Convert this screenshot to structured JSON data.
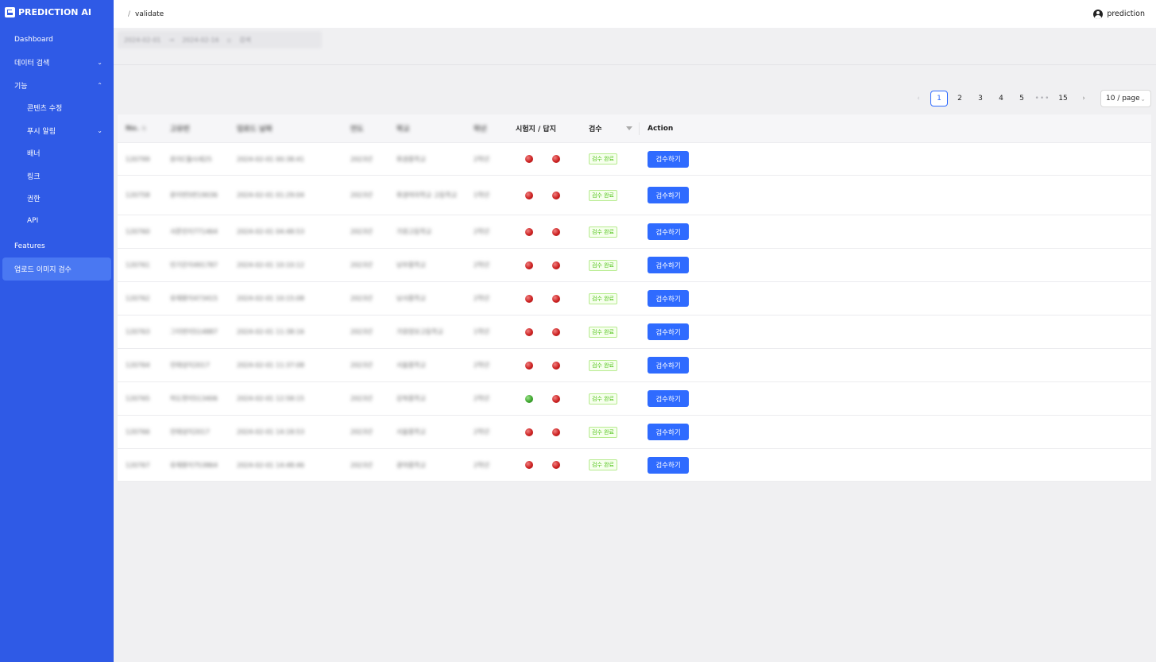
{
  "brand": {
    "name": "PREDICTION AI"
  },
  "sidebar": {
    "items": [
      {
        "label": "Dashboard",
        "chevron": ""
      },
      {
        "label": "데이터 검색",
        "chevron": "⌄"
      },
      {
        "label": "기능",
        "chevron": "⌃"
      },
      {
        "label": "콘텐츠 수정",
        "chevron": ""
      },
      {
        "label": "푸시 알림",
        "chevron": "⌄"
      },
      {
        "label": "배너",
        "chevron": ""
      },
      {
        "label": "링크",
        "chevron": ""
      },
      {
        "label": "권한",
        "chevron": ""
      },
      {
        "label": "API",
        "chevron": ""
      },
      {
        "label": "Features",
        "chevron": ""
      },
      {
        "label": "업로드 이미지 검수",
        "chevron": ""
      }
    ]
  },
  "header": {
    "breadcrumb_sep": "/",
    "breadcrumb_current": "validate",
    "user_name": "prediction"
  },
  "filter": {
    "start_date": "2024-02-01",
    "end_date": "2024-02-16",
    "search_label": "검색"
  },
  "pagination": {
    "pages": [
      "1",
      "2",
      "3",
      "4",
      "5"
    ],
    "dots": "•••",
    "last": "15",
    "prev": "‹",
    "next": "›",
    "page_size": "10 / page"
  },
  "table": {
    "headers": {
      "no": "No.",
      "name": "고유번",
      "date": "업로드 날짜",
      "year": "연도",
      "school": "학교",
      "grade": "학년",
      "paper": "시험지 / 답지",
      "status": "검수",
      "action": "Action"
    },
    "rows": [
      {
        "no": "120799",
        "name": "윤리C월시세25",
        "date": "2024-02-01 00:38:41",
        "year": "2023년",
        "school": "휘경중학교",
        "grade": "2학년",
        "exam": "red",
        "answer": "red",
        "status": "검수 완료",
        "action": "검수하기"
      },
      {
        "no": "120758",
        "name": "윤이번5번19036",
        "date": "2024-02-01 01:29:04",
        "year": "2023년",
        "school": "휘경여자학교 고등학교",
        "grade": "1학년",
        "exam": "red",
        "answer": "red",
        "status": "검수 완료",
        "action": "검수하기"
      },
      {
        "no": "120760",
        "name": "서준민이771464",
        "date": "2024-02-01 04:48:53",
        "year": "2023년",
        "school": "가원고등학교",
        "grade": "2학년",
        "exam": "red",
        "answer": "red",
        "status": "검수 완료",
        "action": "검수하기"
      },
      {
        "no": "120761",
        "name": "민기은이491787",
        "date": "2024-02-01 10:10:12",
        "year": "2023년",
        "school": "남부중학교",
        "grade": "2학년",
        "exam": "red",
        "answer": "red",
        "status": "검수 완료",
        "action": "검수하기"
      },
      {
        "no": "120762",
        "name": "유재환이473415",
        "date": "2024-02-01 10:15:08",
        "year": "2023년",
        "school": "남서중학교",
        "grade": "2학년",
        "exam": "red",
        "answer": "red",
        "status": "검수 완료",
        "action": "검수하기"
      },
      {
        "no": "120763",
        "name": "그이번이514887",
        "date": "2024-02-01 11:38:16",
        "year": "2023년",
        "school": "가원정보고등학교",
        "grade": "1학년",
        "exam": "red",
        "answer": "red",
        "status": "검수 완료",
        "action": "검수하기"
      },
      {
        "no": "120764",
        "name": "진태성이2017",
        "date": "2024-02-01 11:37:08",
        "year": "2023년",
        "school": "서울중학교",
        "grade": "2학년",
        "exam": "red",
        "answer": "red",
        "status": "검수 완료",
        "action": "검수하기"
      },
      {
        "no": "120765",
        "name": "허도현이513406",
        "date": "2024-02-01 12:58:15",
        "year": "2023년",
        "school": "강북중학교",
        "grade": "2학년",
        "exam": "green",
        "answer": "red",
        "status": "검수 완료",
        "action": "검수하기"
      },
      {
        "no": "120766",
        "name": "진태성이2017",
        "date": "2024-02-01 14:18:53",
        "year": "2023년",
        "school": "서울중학교",
        "grade": "2학년",
        "exam": "red",
        "answer": "red",
        "status": "검수 완료",
        "action": "검수하기"
      },
      {
        "no": "120767",
        "name": "유재환이753864",
        "date": "2024-02-01 14:48:46",
        "year": "2023년",
        "school": "광야중학교",
        "grade": "2학년",
        "exam": "red",
        "answer": "red",
        "status": "검수 완료",
        "action": "검수하기"
      }
    ]
  },
  "colors": {
    "sidebar": "#2f5ae6",
    "primary": "#2f6bff",
    "success": "#52c41a",
    "red_dot": "#cc2222",
    "green_dot": "#3ea62f"
  }
}
